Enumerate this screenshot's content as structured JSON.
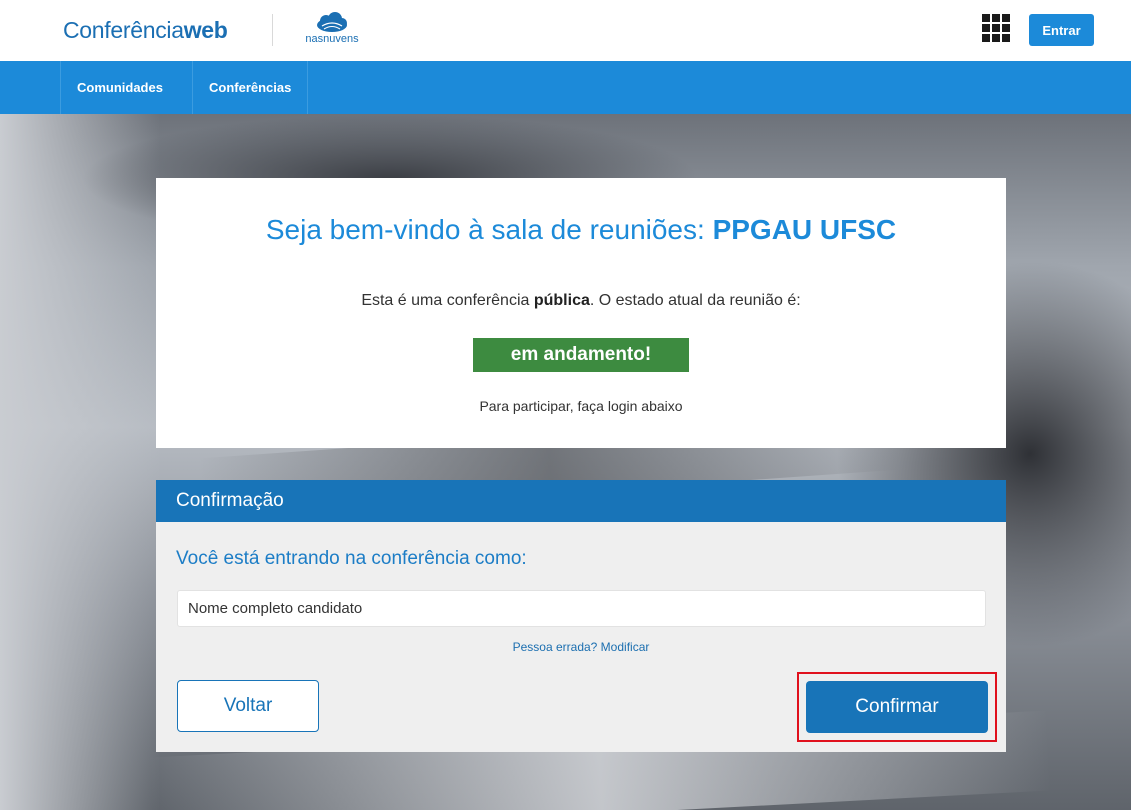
{
  "header": {
    "brand_prefix": "Conferência",
    "brand_suffix": "web",
    "partner_logo_text": "nasnuvens",
    "login_button": "Entrar",
    "apps_icon": "grid-icon"
  },
  "nav": {
    "items": [
      {
        "label": "Comunidades"
      },
      {
        "label": "Conferências"
      }
    ]
  },
  "welcome": {
    "title_prefix": "Seja bem-vindo à sala de reuniões: ",
    "room_name": "PPGAU UFSC",
    "info_prefix": "Esta é uma conferência ",
    "info_bold": "pública",
    "info_suffix": ". O estado atual da reunião é:",
    "status": "em andamento!",
    "hint": "Para participar, faça login abaixo"
  },
  "confirmation": {
    "heading": "Confirmação",
    "subtitle": "Você está entrando na conferência como:",
    "name_value": "Nome completo candidato",
    "change_link": "Pessoa errada? Modificar",
    "back_button": "Voltar",
    "confirm_button": "Confirmar"
  },
  "colors": {
    "primary_blue": "#1c8ad9",
    "dark_blue": "#1874b8",
    "status_green": "#3d8b40",
    "highlight_red": "#e0101c"
  }
}
